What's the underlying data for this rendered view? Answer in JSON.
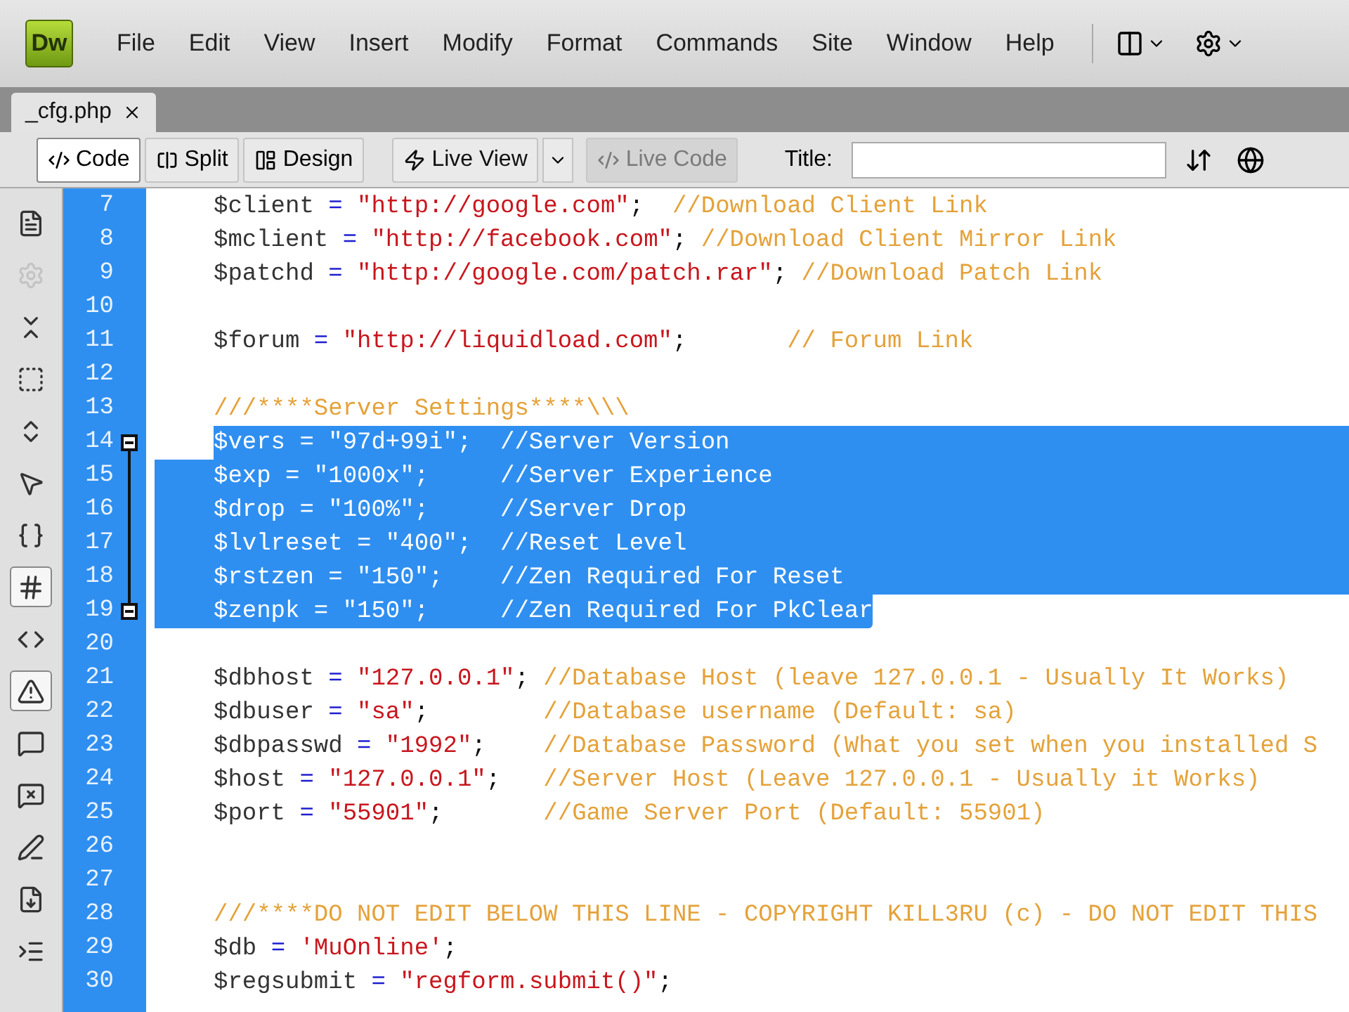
{
  "app": {
    "logo": "Dw"
  },
  "menu": [
    {
      "label": "File"
    },
    {
      "label": "Edit"
    },
    {
      "label": "View"
    },
    {
      "label": "Insert"
    },
    {
      "label": "Modify"
    },
    {
      "label": "Format"
    },
    {
      "label": "Commands"
    },
    {
      "label": "Site"
    },
    {
      "label": "Window"
    },
    {
      "label": "Help"
    }
  ],
  "document_tabs": [
    {
      "label": "_cfg.php",
      "selected": true
    }
  ],
  "view_buttons": [
    {
      "label": "Code",
      "kind": "code",
      "selected": true
    },
    {
      "label": "Split",
      "kind": "split",
      "selected": false
    },
    {
      "label": "Design",
      "kind": "design",
      "selected": false
    }
  ],
  "live_buttons": [
    {
      "label": "Live View",
      "kind": "live_view",
      "disabled": false
    },
    {
      "label": "Live Code",
      "kind": "live_code",
      "disabled": true
    }
  ],
  "title_field": {
    "label": "Title:"
  },
  "side_tools": [
    {
      "kind": "file",
      "on": false,
      "disabled": false
    },
    {
      "kind": "gear",
      "on": false,
      "disabled": true
    },
    {
      "kind": "collapse",
      "on": false,
      "disabled": false
    },
    {
      "kind": "collapse_sel",
      "on": false,
      "disabled": false
    },
    {
      "kind": "expand",
      "on": false,
      "disabled": false
    },
    {
      "kind": "select_parent",
      "on": false,
      "disabled": false
    },
    {
      "kind": "braces",
      "on": false,
      "disabled": false
    },
    {
      "kind": "line_numbers",
      "on": true,
      "disabled": false
    },
    {
      "kind": "invalid",
      "on": false,
      "disabled": false
    },
    {
      "kind": "warning",
      "on": true,
      "disabled": false
    },
    {
      "kind": "comment",
      "on": false,
      "disabled": false
    },
    {
      "kind": "uncomment",
      "on": false,
      "disabled": false
    },
    {
      "kind": "wrap",
      "on": false,
      "disabled": false
    },
    {
      "kind": "snippets",
      "on": false,
      "disabled": false
    },
    {
      "kind": "indent",
      "on": false,
      "disabled": false
    }
  ],
  "code_lines": [
    {
      "number": "7",
      "selected": false,
      "tokens": [
        {
          "kind": "var",
          "t": "$client "
        },
        {
          "kind": "op",
          "t": "="
        },
        {
          "kind": "str",
          "t": " \"http://google.com\""
        },
        {
          "kind": "p",
          "t": ";  "
        },
        {
          "kind": "cm",
          "t": "//Download Client Link"
        }
      ]
    },
    {
      "number": "8",
      "selected": false,
      "tokens": [
        {
          "kind": "var",
          "t": "$mclient "
        },
        {
          "kind": "op",
          "t": "="
        },
        {
          "kind": "str",
          "t": " \"http://facebook.com\""
        },
        {
          "kind": "p",
          "t": "; "
        },
        {
          "kind": "cm",
          "t": "//Download Client Mirror Link"
        }
      ]
    },
    {
      "number": "9",
      "selected": false,
      "tokens": [
        {
          "kind": "var",
          "t": "$patchd "
        },
        {
          "kind": "op",
          "t": "="
        },
        {
          "kind": "str",
          "t": " \"http://google.com/patch.rar\""
        },
        {
          "kind": "p",
          "t": "; "
        },
        {
          "kind": "cm",
          "t": "//Download Patch Link"
        }
      ]
    },
    {
      "number": "10",
      "selected": false
    },
    {
      "number": "11",
      "selected": false,
      "tokens": [
        {
          "kind": "var",
          "t": "$forum "
        },
        {
          "kind": "op",
          "t": "="
        },
        {
          "kind": "str",
          "t": " \"http://liquidload.com\""
        },
        {
          "kind": "p",
          "t": ";       "
        },
        {
          "kind": "cm",
          "t": "// Forum Link"
        }
      ]
    },
    {
      "number": "12",
      "selected": false
    },
    {
      "number": "13",
      "selected": false,
      "tokens": [
        {
          "kind": "cm",
          "t": "///****Server Settings****\\\\\\"
        }
      ]
    },
    {
      "number": "14",
      "selected": true,
      "text": "$vers = \"97d+99i\";  //Server Version"
    },
    {
      "number": "15",
      "selected": true,
      "text": "$exp = \"1000x\";     //Server Experience"
    },
    {
      "number": "16",
      "selected": true,
      "text": "$drop = \"100%\";     //Server Drop"
    },
    {
      "number": "17",
      "selected": true,
      "text": "$lvlreset = \"400\";  //Reset Level"
    },
    {
      "number": "18",
      "selected": true,
      "text": "$rstzen = \"150\";    //Zen Required For Reset"
    },
    {
      "number": "19",
      "selected": true,
      "text": "$zenpk = \"150\";     //Zen Required For PkClear"
    },
    {
      "number": "20",
      "selected": false
    },
    {
      "number": "21",
      "selected": false,
      "tokens": [
        {
          "kind": "var",
          "t": "$dbhost "
        },
        {
          "kind": "op",
          "t": "="
        },
        {
          "kind": "str",
          "t": " \"127.0.0.1\""
        },
        {
          "kind": "p",
          "t": "; "
        },
        {
          "kind": "cm",
          "t": "//Database Host (leave 127.0.0.1 - Usually It Works)"
        }
      ]
    },
    {
      "number": "22",
      "selected": false,
      "tokens": [
        {
          "kind": "var",
          "t": "$dbuser "
        },
        {
          "kind": "op",
          "t": "="
        },
        {
          "kind": "str",
          "t": " \"sa\""
        },
        {
          "kind": "p",
          "t": ";        "
        },
        {
          "kind": "cm",
          "t": "//Database username (Default: sa)"
        }
      ]
    },
    {
      "number": "23",
      "selected": false,
      "tokens": [
        {
          "kind": "var",
          "t": "$dbpasswd "
        },
        {
          "kind": "op",
          "t": "="
        },
        {
          "kind": "str",
          "t": " \"1992\""
        },
        {
          "kind": "p",
          "t": ";    "
        },
        {
          "kind": "cm",
          "t": "//Database Password (What you set when you installed S"
        }
      ]
    },
    {
      "number": "24",
      "selected": false,
      "tokens": [
        {
          "kind": "var",
          "t": "$host "
        },
        {
          "kind": "op",
          "t": "="
        },
        {
          "kind": "str",
          "t": " \"127.0.0.1\""
        },
        {
          "kind": "p",
          "t": ";   "
        },
        {
          "kind": "cm",
          "t": "//Server Host (Leave 127.0.0.1 - Usually it Works)"
        }
      ]
    },
    {
      "number": "25",
      "selected": false,
      "tokens": [
        {
          "kind": "var",
          "t": "$port "
        },
        {
          "kind": "op",
          "t": "="
        },
        {
          "kind": "str",
          "t": " \"55901\""
        },
        {
          "kind": "p",
          "t": ";       "
        },
        {
          "kind": "cm",
          "t": "//Game Server Port (Default: 55901)"
        }
      ]
    },
    {
      "number": "26",
      "selected": false
    },
    {
      "number": "27",
      "selected": false
    },
    {
      "number": "28",
      "selected": false,
      "tokens": [
        {
          "kind": "cm",
          "t": "///****DO NOT EDIT BELOW THIS LINE - COPYRIGHT KILL3RU (c) - DO NOT EDIT THIS"
        }
      ]
    },
    {
      "number": "29",
      "selected": false,
      "tokens": [
        {
          "kind": "var",
          "t": "$db "
        },
        {
          "kind": "op",
          "t": "="
        },
        {
          "kind": "str",
          "t": " 'MuOnline'"
        },
        {
          "kind": "p",
          "t": ";"
        }
      ]
    },
    {
      "number": "30",
      "selected": false,
      "tokens": [
        {
          "kind": "var",
          "t": "$regsubmit "
        },
        {
          "kind": "op",
          "t": "="
        },
        {
          "kind": "str",
          "t": " \"regform.submit()\""
        },
        {
          "kind": "p",
          "t": ";"
        }
      ]
    }
  ]
}
